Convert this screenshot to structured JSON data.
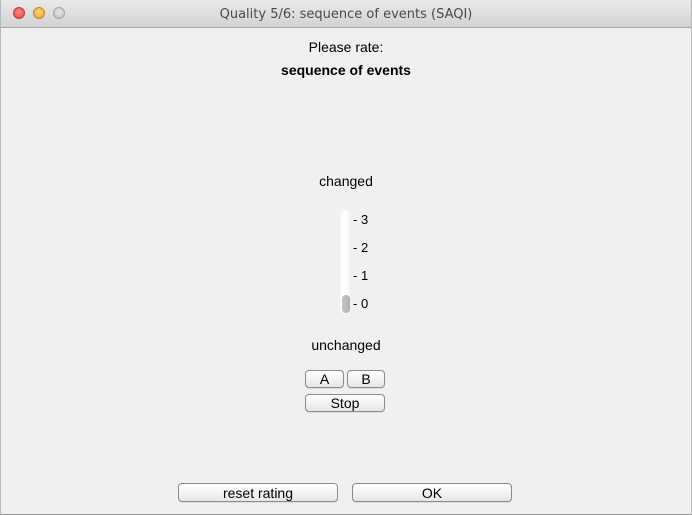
{
  "window": {
    "title": "Quality 5/6: sequence of events (SAQI)"
  },
  "rating": {
    "prompt": "Please rate:",
    "attribute": "sequence of events",
    "label_top": "changed",
    "label_bottom": "unchanged",
    "scale_ticks": [
      "- 3",
      "- 2",
      "- 1",
      "- 0"
    ],
    "current_value": 0,
    "min": 0,
    "max": 3
  },
  "playback": {
    "a_label": "A",
    "b_label": "B",
    "stop_label": "Stop"
  },
  "footer": {
    "reset_label": "reset rating",
    "ok_label": "OK"
  }
}
